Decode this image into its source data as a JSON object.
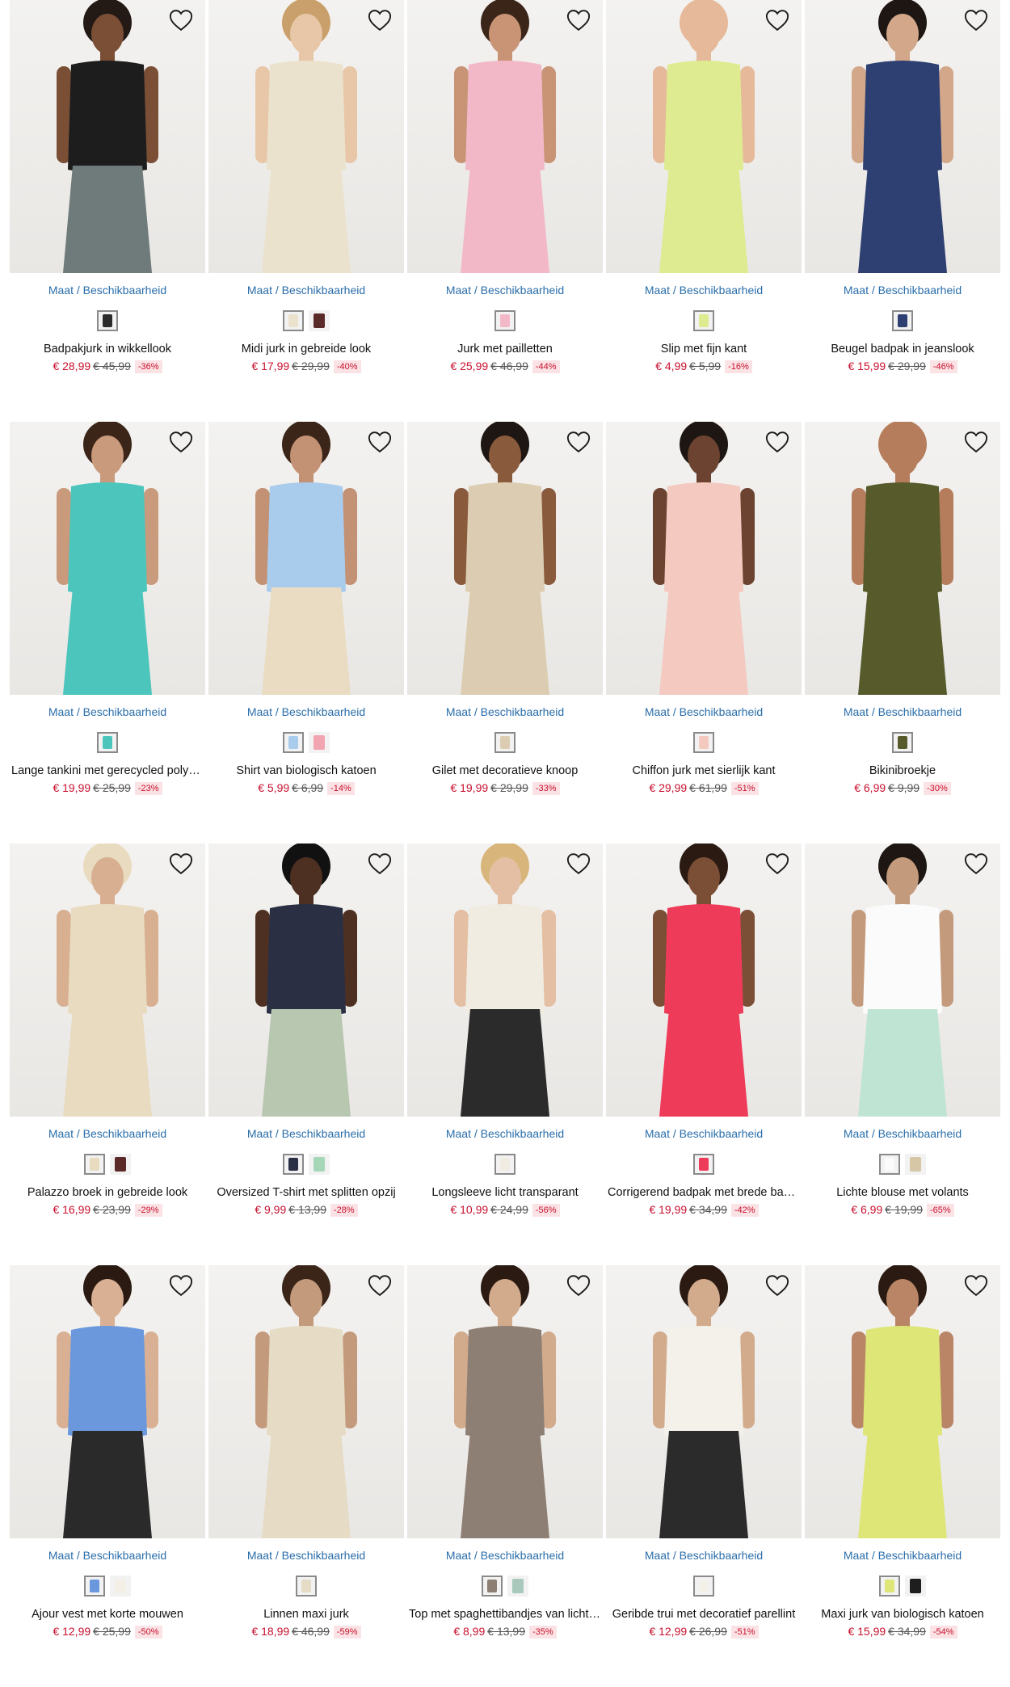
{
  "size_link_label": "Maat / Beschikbaarheid",
  "colors": {
    "price": "#c8102e",
    "link": "#2a6eaa",
    "badge_bg": "#fbe3e5"
  },
  "products": [
    {
      "name": "Badpakjurk in wikkellook",
      "price": "€ 28,99",
      "old_price": "€ 45,99",
      "discount": "-36%",
      "garment": "#1d1d1d",
      "accent": "#6f7b7a",
      "skin": "#7a4f36",
      "hair": "#231915",
      "swatches": [
        "#2b2b2b"
      ]
    },
    {
      "name": "Midi jurk in gebreide look",
      "price": "€ 17,99",
      "old_price": "€ 29,99",
      "discount": "-40%",
      "garment": "#ebe2cd",
      "accent": "#ebe2cd",
      "skin": "#e8c7a8",
      "hair": "#c9a06b",
      "swatches": [
        "#ebe2cd",
        "#5a2a28"
      ]
    },
    {
      "name": "Jurk met pailletten",
      "price": "€ 25,99",
      "old_price": "€ 46,99",
      "discount": "-44%",
      "garment": "#f2b8c8",
      "accent": "#f2b8c8",
      "skin": "#c99476",
      "hair": "#3a2518",
      "swatches": [
        "#f2b8c8"
      ]
    },
    {
      "name": "Slip met fijn kant",
      "price": "€ 4,99",
      "old_price": "€ 5,99",
      "discount": "-16%",
      "garment": "#dfeb90",
      "accent": "#dfeb90",
      "skin": "#e6b99a",
      "hair": "#e6b99a",
      "swatches": [
        "#dfeb90"
      ]
    },
    {
      "name": "Beugel badpak in jeanslook",
      "price": "€ 15,99",
      "old_price": "€ 29,99",
      "discount": "-46%",
      "garment": "#2e3f72",
      "accent": "#2e3f72",
      "skin": "#d3a88a",
      "hair": "#1d1612",
      "swatches": [
        "#2e3f72"
      ]
    },
    {
      "name": "Lange tankini met gerecycled polyamide",
      "price": "€ 19,99",
      "old_price": "€ 25,99",
      "discount": "-23%",
      "garment": "#4cc6bd",
      "accent": "#4cc6bd",
      "skin": "#c99a7c",
      "hair": "#3a2518",
      "swatches": [
        "#4cc6bd"
      ]
    },
    {
      "name": "Shirt van biologisch katoen",
      "price": "€ 5,99",
      "old_price": "€ 6,99",
      "discount": "-14%",
      "garment": "#a9cbec",
      "accent": "#e9dcc2",
      "skin": "#c39173",
      "hair": "#3a2518",
      "swatches": [
        "#a9cbec",
        "#f2a5b0"
      ]
    },
    {
      "name": "Gilet met decoratieve knoop",
      "price": "€ 19,99",
      "old_price": "€ 29,99",
      "discount": "-33%",
      "garment": "#dccdb2",
      "accent": "#dccdb2",
      "skin": "#8a5a3d",
      "hair": "#1d1612",
      "swatches": [
        "#dccdb2"
      ]
    },
    {
      "name": "Chiffon jurk met sierlijk kant",
      "price": "€ 29,99",
      "old_price": "€ 61,99",
      "discount": "-51%",
      "garment": "#f3c9c0",
      "accent": "#f3c9c0",
      "skin": "#6b4330",
      "hair": "#1d1612",
      "swatches": [
        "#f3c9c0"
      ]
    },
    {
      "name": "Bikinibroekje",
      "price": "€ 6,99",
      "old_price": "€ 9,99",
      "discount": "-30%",
      "garment": "#575b2c",
      "accent": "#575b2c",
      "skin": "#b57d5c",
      "hair": "#b57d5c",
      "swatches": [
        "#575b2c"
      ]
    },
    {
      "name": "Palazzo broek in gebreide look",
      "price": "€ 16,99",
      "old_price": "€ 23,99",
      "discount": "-29%",
      "garment": "#e8dbc0",
      "accent": "#e8dbc0",
      "skin": "#d8b091",
      "hair": "#e8dbc0",
      "swatches": [
        "#e8dbc0",
        "#5a2a28"
      ]
    },
    {
      "name": "Oversized T-shirt met splitten opzij",
      "price": "€ 9,99",
      "old_price": "€ 13,99",
      "discount": "-28%",
      "garment": "#2a2f44",
      "accent": "#b8c7b0",
      "skin": "#4e3022",
      "hair": "#111111",
      "swatches": [
        "#2a2f44",
        "#a6d6b8"
      ]
    },
    {
      "name": "Longsleeve licht transparant",
      "price": "€ 10,99",
      "old_price": "€ 24,99",
      "discount": "-56%",
      "garment": "#f1ece2",
      "accent": "#2b2b2b",
      "skin": "#e4bfa3",
      "hair": "#d8b57a",
      "swatches": [
        "#f1ece2"
      ]
    },
    {
      "name": "Corrigerend badpak met brede bandjes",
      "price": "€ 19,99",
      "old_price": "€ 34,99",
      "discount": "-42%",
      "garment": "#ef3b5a",
      "accent": "#ef3b5a",
      "skin": "#7a4f36",
      "hair": "#2a1a12",
      "swatches": [
        "#ef3b5a"
      ]
    },
    {
      "name": "Lichte blouse met volants",
      "price": "€ 6,99",
      "old_price": "€ 19,99",
      "discount": "-65%",
      "garment": "#fbfbfb",
      "accent": "#bfe4d4",
      "skin": "#c49a7c",
      "hair": "#1d1612",
      "swatches": [
        "#fbfbfb",
        "#d6c7a6"
      ]
    },
    {
      "name": "Ajour vest met korte mouwen",
      "price": "€ 12,99",
      "old_price": "€ 25,99",
      "discount": "-50%",
      "garment": "#6b98dd",
      "accent": "#2a2a2a",
      "skin": "#d9b093",
      "hair": "#2a1a12",
      "swatches": [
        "#6b98dd",
        "#f3efe6"
      ]
    },
    {
      "name": "Linnen maxi jurk",
      "price": "€ 18,99",
      "old_price": "€ 46,99",
      "discount": "-59%",
      "garment": "#e6dcc5",
      "accent": "#e6dcc5",
      "skin": "#c49a7c",
      "hair": "#3a2518",
      "swatches": [
        "#e6dcc5"
      ]
    },
    {
      "name": "Top met spaghettibandjes van licht materiaal",
      "price": "€ 8,99",
      "old_price": "€ 13,99",
      "discount": "-35%",
      "garment": "#8e7f74",
      "accent": "#8e7f74",
      "skin": "#d2aa8c",
      "hair": "#2a1a12",
      "swatches": [
        "#8e7f74",
        "#a9c9bd"
      ]
    },
    {
      "name": "Geribde trui met decoratief parellint",
      "price": "€ 12,99",
      "old_price": "€ 26,99",
      "discount": "-51%",
      "garment": "#f4f1ea",
      "accent": "#2b2b2b",
      "skin": "#d2aa8c",
      "hair": "#2a1a12",
      "swatches": [
        "#f4f1ea"
      ]
    },
    {
      "name": "Maxi jurk van biologisch katoen",
      "price": "€ 15,99",
      "old_price": "€ 34,99",
      "discount": "-54%",
      "garment": "#dde676",
      "accent": "#dde676",
      "skin": "#b98566",
      "hair": "#2a1a12",
      "swatches": [
        "#dde676",
        "#1e1e1e"
      ]
    }
  ]
}
